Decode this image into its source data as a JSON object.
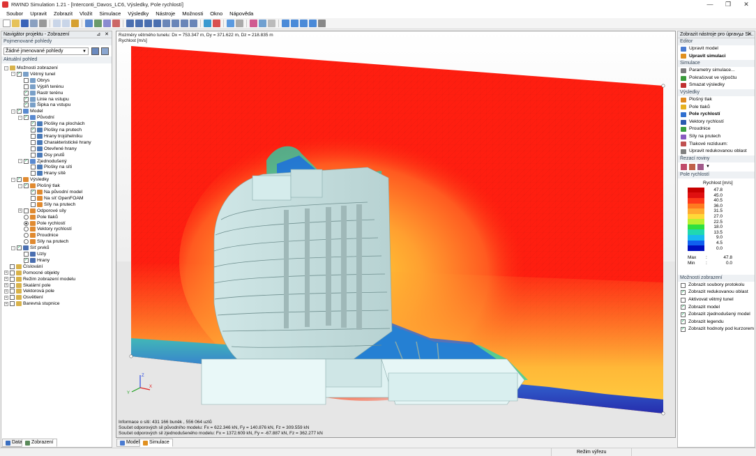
{
  "window": {
    "title": "RWIND Simulation 1.21 - [Interconti_Davos_LC6, Výsledky, Pole rychlostí]",
    "min_icon": "minimize-icon",
    "max_icon": "maximize-icon",
    "close_icon": "close-icon"
  },
  "menu": [
    "Soubor",
    "Upravit",
    "Zobrazit",
    "Vložit",
    "Simulace",
    "Výsledky",
    "Nástroje",
    "Možnosti",
    "Okno",
    "Nápověda"
  ],
  "navigator": {
    "title": "Navigátor projektu - Zobrazení",
    "named_views_label": "Pojmenované pohledy",
    "named_views_value": "Žádné jmenované pohledy",
    "current_view_label": "Aktuální pohled",
    "tree": [
      {
        "label": "Možnosti zobrazení",
        "level": 0,
        "exp": "-",
        "check": null,
        "icon": "folder"
      },
      {
        "label": "Větrný tunel",
        "level": 1,
        "exp": "-",
        "check": true,
        "icon": "tunnel"
      },
      {
        "label": "Obrys",
        "level": 2,
        "exp": null,
        "check": false,
        "icon": "tunnel"
      },
      {
        "label": "Výplň terénu",
        "level": 2,
        "exp": null,
        "check": false,
        "icon": "tunnel"
      },
      {
        "label": "Rastr terénu",
        "level": 2,
        "exp": null,
        "check": true,
        "icon": "tunnel"
      },
      {
        "label": "Linie na vstupu",
        "level": 2,
        "exp": null,
        "check": true,
        "icon": "tunnel"
      },
      {
        "label": "Šipka na vstupu",
        "level": 2,
        "exp": null,
        "check": true,
        "icon": "tunnel"
      },
      {
        "label": "Model",
        "level": 1,
        "exp": "-",
        "check": true,
        "icon": "model"
      },
      {
        "label": "Původní",
        "level": 2,
        "exp": "-",
        "check": true,
        "icon": "model"
      },
      {
        "label": "Plošky na plochách",
        "level": 3,
        "exp": null,
        "check": true,
        "icon": "mesh"
      },
      {
        "label": "Plošky na prutech",
        "level": 3,
        "exp": null,
        "check": true,
        "icon": "mesh"
      },
      {
        "label": "Hrany trojúhelníku",
        "level": 3,
        "exp": null,
        "check": false,
        "icon": "mesh"
      },
      {
        "label": "Charakteristické hrany",
        "level": 3,
        "exp": null,
        "check": false,
        "icon": "mesh"
      },
      {
        "label": "Otevřené hrany",
        "level": 3,
        "exp": null,
        "check": false,
        "icon": "mesh"
      },
      {
        "label": "Osy prutů",
        "level": 3,
        "exp": null,
        "check": false,
        "icon": "mesh"
      },
      {
        "label": "Zjednodušený",
        "level": 2,
        "exp": "-",
        "check": true,
        "icon": "model"
      },
      {
        "label": "Plošky na síti",
        "level": 3,
        "exp": null,
        "check": false,
        "icon": "mesh"
      },
      {
        "label": "Hrany sítě",
        "level": 3,
        "exp": null,
        "check": false,
        "icon": "mesh"
      },
      {
        "label": "Výsledky",
        "level": 1,
        "exp": "-",
        "check": true,
        "icon": "results"
      },
      {
        "label": "Plošný tlak",
        "level": 2,
        "exp": "-",
        "check": true,
        "icon": "results"
      },
      {
        "label": "Na původní model",
        "level": 3,
        "exp": null,
        "check": true,
        "icon": "results"
      },
      {
        "label": "Na síť OpenFOAM",
        "level": 3,
        "exp": null,
        "check": false,
        "icon": "results"
      },
      {
        "label": "Síly na prutech",
        "level": 3,
        "exp": null,
        "check": false,
        "icon": "results"
      },
      {
        "label": "Odporové síly",
        "level": 2,
        "exp": "+",
        "check": false,
        "icon": "results"
      },
      {
        "label": "Pole tlaků",
        "level": 2,
        "exp": null,
        "radio": false,
        "icon": "results"
      },
      {
        "label": "Pole rychlostí",
        "level": 2,
        "exp": null,
        "radio": true,
        "icon": "results"
      },
      {
        "label": "Vektory rychlostí",
        "level": 2,
        "exp": null,
        "radio": false,
        "icon": "results"
      },
      {
        "label": "Proudnice",
        "level": 2,
        "exp": null,
        "radio": false,
        "icon": "results"
      },
      {
        "label": "Síly na prutech",
        "level": 2,
        "exp": null,
        "radio": false,
        "icon": "results"
      },
      {
        "label": "Síť prvků",
        "level": 1,
        "exp": "-",
        "check": true,
        "icon": "meshblue"
      },
      {
        "label": "Uzly",
        "level": 2,
        "exp": null,
        "check": false,
        "icon": "meshblue"
      },
      {
        "label": "Hrany",
        "level": 2,
        "exp": null,
        "check": true,
        "icon": "meshblue"
      },
      {
        "label": "Číslování",
        "level": 0,
        "exp": null,
        "check": false,
        "icon": "folder"
      },
      {
        "label": "Pomocné objekty",
        "level": 0,
        "exp": "+",
        "check": false,
        "icon": "folder"
      },
      {
        "label": "Režim zobrazení modelu",
        "level": 0,
        "exp": "+",
        "check": false,
        "icon": "folder"
      },
      {
        "label": "Skalární pole",
        "level": 0,
        "exp": "+",
        "check": false,
        "icon": "folder"
      },
      {
        "label": "Vektorová pole",
        "level": 0,
        "exp": "+",
        "check": false,
        "icon": "folder"
      },
      {
        "label": "Osvětlení",
        "level": 0,
        "exp": "+",
        "check": false,
        "icon": "folder"
      },
      {
        "label": "Barevná stupnice",
        "level": 0,
        "exp": "+",
        "check": false,
        "icon": "folder"
      }
    ],
    "tabs": [
      "Data",
      "Zobrazení"
    ]
  },
  "viewport": {
    "info_top": "Rozměry větrného tunelu: Dx = 753.347 m, Dy = 371.622 m, Dz = 218.835 m",
    "info_top2": "Rychlost [m/s]",
    "info_bottom": [
      "Informace o síti: 431 166 buněk , 556 064 uzlů",
      "Součet odporových sil původního modelu: Fx = 622.346 kN, Fy = 140.876 kN, Fz = 309.559 kN",
      "Součet odporových sil zjednodušeného modelu: Fx = 1372.609 kN, Fy = -67.887 kN, Fz = 362.277 kN"
    ],
    "axes": {
      "x": "X",
      "y": "Y",
      "z": "Z"
    },
    "tabs": [
      "Model",
      "Simulace"
    ]
  },
  "right_panel": {
    "title": "Zobrazit nástroje pro úpravy - Si...",
    "sections": {
      "editor": {
        "label": "Editor",
        "items": [
          {
            "label": "Upravit model",
            "bold": false,
            "color": "#4a7bd1"
          },
          {
            "label": "Upravit simulaci",
            "bold": true,
            "color": "#e09020"
          }
        ]
      },
      "simulace": {
        "label": "Simulace",
        "items": [
          {
            "label": "Parametry simulace...",
            "bold": false,
            "color": "#7a7a7a"
          },
          {
            "label": "Pokračovat ve výpočtu",
            "bold": false,
            "color": "#3a9a3a"
          },
          {
            "label": "Smazat výsledky",
            "bold": false,
            "color": "#c03030"
          }
        ]
      },
      "vysledky": {
        "label": "Výsledky",
        "items": [
          {
            "label": "Plošný tlak",
            "bold": false,
            "color": "#e08a20"
          },
          {
            "label": "Pole tlaků",
            "bold": false,
            "color": "#e6b020"
          },
          {
            "label": "Pole rychlostí",
            "bold": true,
            "color": "#3070d0"
          },
          {
            "label": "Vektory rychlostí",
            "bold": false,
            "color": "#2a5ab0"
          },
          {
            "label": "Proudnice",
            "bold": false,
            "color": "#3aa040"
          },
          {
            "label": "Síly na prutech",
            "bold": false,
            "color": "#8a5ac0"
          },
          {
            "label": "Tlakové reziduum:",
            "bold": false,
            "color": "#c05050"
          },
          {
            "label": "Upravit redukovanou oblast",
            "bold": false,
            "color": "#808080"
          }
        ]
      },
      "rezne_roviny": {
        "label": "Řezací roviny"
      },
      "pole_rychlosti": {
        "label": "Pole rychlostí"
      }
    },
    "legend": {
      "title": "Rychlost [m/s]",
      "values": [
        "47.8",
        "45.0",
        "40.5",
        "36.0",
        "31.5",
        "27.0",
        "22.5",
        "18.0",
        "13.5",
        "9.0",
        "4.5",
        "0.0"
      ],
      "colors": [
        "#c80000",
        "#e01010",
        "#ff3a1a",
        "#ff7a20",
        "#ffaa30",
        "#ffd838",
        "#b8f030",
        "#30e040",
        "#20d8b0",
        "#18b8f0",
        "#1060f0",
        "#0010c0"
      ],
      "max_label": "Max",
      "max_sep": ":",
      "max_value": "47.8",
      "min_label": "Min",
      "min_sep": ":",
      "min_value": "0.0"
    },
    "options": {
      "label": "Možnosti zobrazení",
      "items": [
        {
          "label": "Zobrazit soubory protokolu",
          "checked": false
        },
        {
          "label": "Zobrazit redukovanou oblast",
          "checked": true
        },
        {
          "label": "Aktivovat větrný tunel",
          "checked": false
        },
        {
          "label": "Zobrazit model",
          "checked": true
        },
        {
          "label": "Zobrazit zjednodušený model",
          "checked": true
        },
        {
          "label": "Zobrazit legendu",
          "checked": true
        },
        {
          "label": "Zobrazit hodnoty pod kurzorem",
          "checked": true
        }
      ]
    }
  },
  "status": {
    "mode": "Režim výřezu"
  }
}
